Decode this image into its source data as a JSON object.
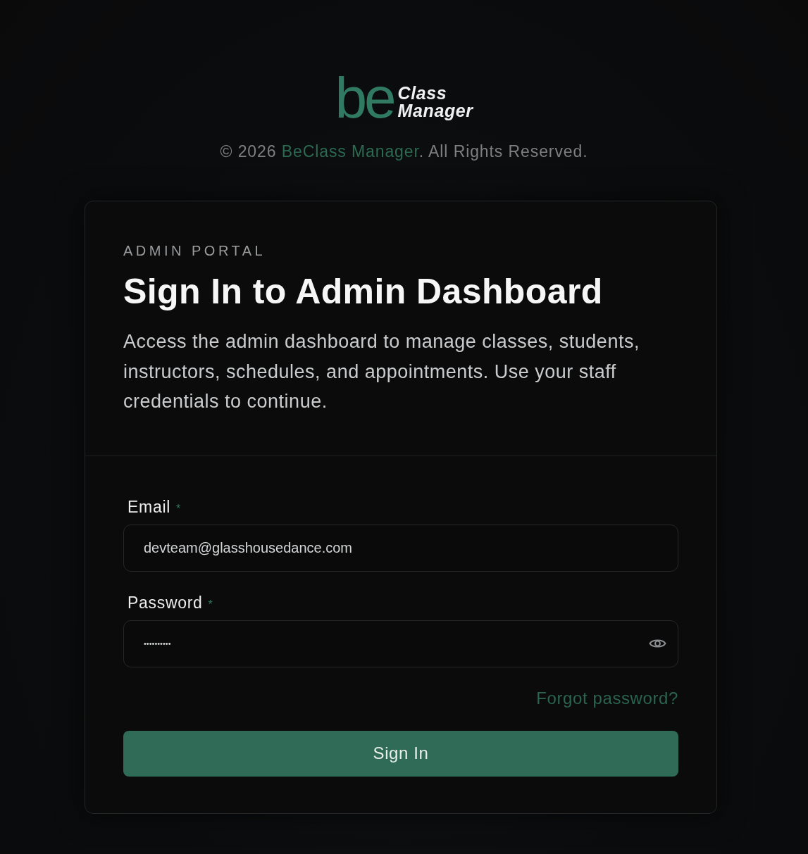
{
  "header": {
    "logo": {
      "mark": "be",
      "line_1": "Class",
      "line_2": "Manager"
    },
    "copyright": {
      "prefix": "© 2026 ",
      "link": "BeClass Manager",
      "suffix": ". All Rights Reserved."
    }
  },
  "card": {
    "eyebrow": "ADMIN PORTAL",
    "title": "Sign In to Admin Dashboard",
    "description": "Access the admin dashboard to manage classes, students, instructors, schedules, and appointments. Use your staff credentials to continue.",
    "fields": [
      {
        "kind": "email",
        "label": "Email",
        "required_mark": "*",
        "value": "devteam@glasshousedance.com"
      },
      {
        "kind": "password",
        "label": "Password",
        "required_mark": "*",
        "value": "••••••••••"
      }
    ],
    "forgot_link": "Forgot password?",
    "submit": "Sign In"
  }
}
